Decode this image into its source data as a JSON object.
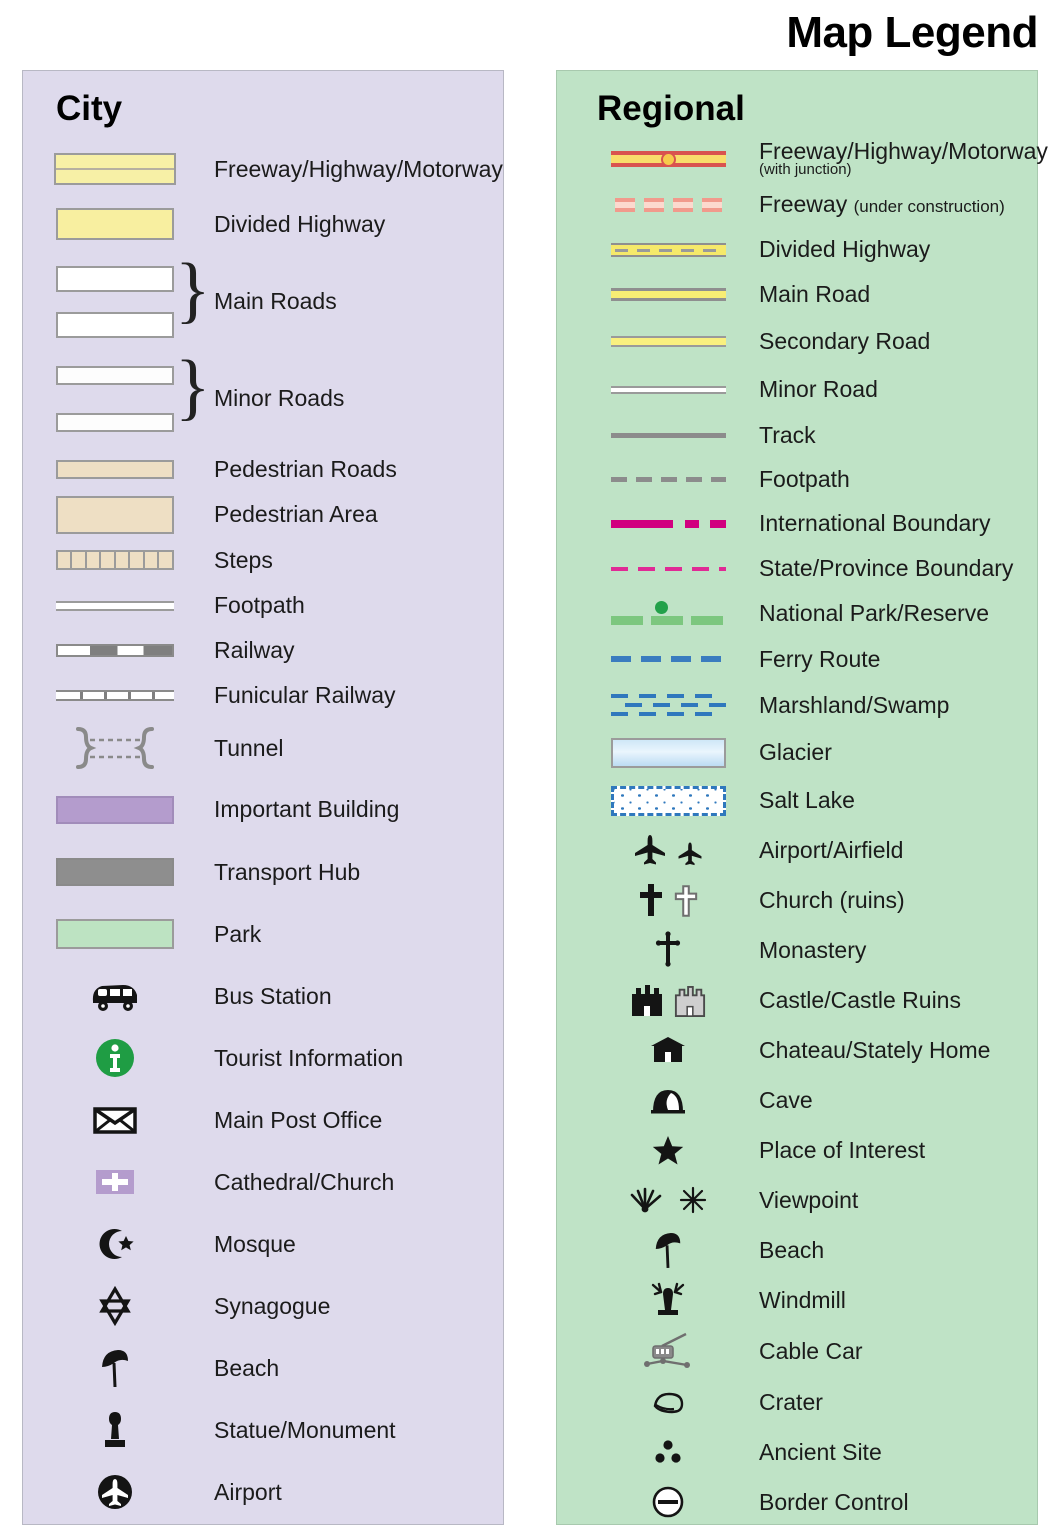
{
  "title": "Map Legend",
  "city": {
    "heading": "City",
    "items": [
      {
        "label": "Freeway/Highway/Motorway",
        "symbol": "freeway-city"
      },
      {
        "label": "Divided Highway",
        "symbol": "divided-highway-city"
      },
      {
        "label": "Main Roads",
        "symbol": "main-roads-braced"
      },
      {
        "label": "Minor Roads",
        "symbol": "minor-roads-braced"
      },
      {
        "label": "Pedestrian Roads",
        "symbol": "pedestrian-road"
      },
      {
        "label": "Pedestrian Area",
        "symbol": "pedestrian-area"
      },
      {
        "label": "Steps",
        "symbol": "steps"
      },
      {
        "label": "Footpath",
        "symbol": "footpath-city"
      },
      {
        "label": "Railway",
        "symbol": "railway"
      },
      {
        "label": "Funicular Railway",
        "symbol": "funicular-railway"
      },
      {
        "label": "Tunnel",
        "symbol": "tunnel"
      },
      {
        "label": "Important Building",
        "symbol": "important-building"
      },
      {
        "label": "Transport Hub",
        "symbol": "transport-hub"
      },
      {
        "label": "Park",
        "symbol": "park"
      },
      {
        "label": "Bus Station",
        "symbol": "bus-icon"
      },
      {
        "label": "Tourist Information",
        "symbol": "information-icon"
      },
      {
        "label": "Main Post Office",
        "symbol": "envelope-icon"
      },
      {
        "label": "Cathedral/Church",
        "symbol": "church-cross-icon"
      },
      {
        "label": "Mosque",
        "symbol": "crescent-star-icon"
      },
      {
        "label": "Synagogue",
        "symbol": "star-of-david-icon"
      },
      {
        "label": "Beach",
        "symbol": "parasol-icon"
      },
      {
        "label": "Statue/Monument",
        "symbol": "monument-icon"
      },
      {
        "label": "Airport",
        "symbol": "airport-icon"
      }
    ]
  },
  "regional": {
    "heading": "Regional",
    "items": [
      {
        "label": "Freeway/Highway/Motorway",
        "sublabel": "(with junction)",
        "symbol": "freeway-junction"
      },
      {
        "label": "Freeway",
        "sublabel": "(under construction)",
        "symbol": "freeway-under-construction"
      },
      {
        "label": "Divided Highway",
        "symbol": "divided-highway-regional"
      },
      {
        "label": "Main Road",
        "symbol": "main-road"
      },
      {
        "label": "Secondary Road",
        "symbol": "secondary-road"
      },
      {
        "label": "Minor Road",
        "symbol": "minor-road"
      },
      {
        "label": "Track",
        "symbol": "track"
      },
      {
        "label": "Footpath",
        "symbol": "footpath-regional"
      },
      {
        "label": "International Boundary",
        "symbol": "international-boundary"
      },
      {
        "label": "State/Province Boundary",
        "symbol": "state-boundary"
      },
      {
        "label": "National Park/Reserve",
        "symbol": "national-park"
      },
      {
        "label": "Ferry Route",
        "symbol": "ferry-route"
      },
      {
        "label": "Marshland/Swamp",
        "symbol": "marshland"
      },
      {
        "label": "Glacier",
        "symbol": "glacier"
      },
      {
        "label": "Salt Lake",
        "symbol": "salt-lake"
      },
      {
        "label": "Airport/Airfield",
        "symbol": "airport-airfield-icon"
      },
      {
        "label": "Church (ruins)",
        "symbol": "church-ruins-icon"
      },
      {
        "label": "Monastery",
        "symbol": "monastery-cross-icon"
      },
      {
        "label": "Castle/Castle Ruins",
        "symbol": "castle-icon"
      },
      {
        "label": "Chateau/Stately Home",
        "symbol": "chateau-icon"
      },
      {
        "label": "Cave",
        "symbol": "cave-icon"
      },
      {
        "label": "Place of Interest",
        "symbol": "star-icon"
      },
      {
        "label": "Viewpoint",
        "symbol": "viewpoint-icon"
      },
      {
        "label": "Beach",
        "symbol": "parasol-icon"
      },
      {
        "label": "Windmill",
        "symbol": "windmill-icon"
      },
      {
        "label": "Cable Car",
        "symbol": "cable-car-icon"
      },
      {
        "label": "Crater",
        "symbol": "crater-icon"
      },
      {
        "label": "Ancient Site",
        "symbol": "ancient-site-icon"
      },
      {
        "label": "Border Control",
        "symbol": "border-control-icon"
      }
    ]
  },
  "colors": {
    "city_panel": "#dedaec",
    "regional_panel": "#bfe3c6",
    "highway_yellow": "#f8efa0",
    "pedestrian_tan": "#eedfc4",
    "important_building_purple": "#b49ccd",
    "transport_hub_gray": "#8e8e8e",
    "park_green": "#bde3c2",
    "freeway_red": "#d9534f",
    "boundary_magenta": "#d1007f",
    "ferry_blue": "#3a7cbf",
    "info_green": "#1f9d44"
  }
}
